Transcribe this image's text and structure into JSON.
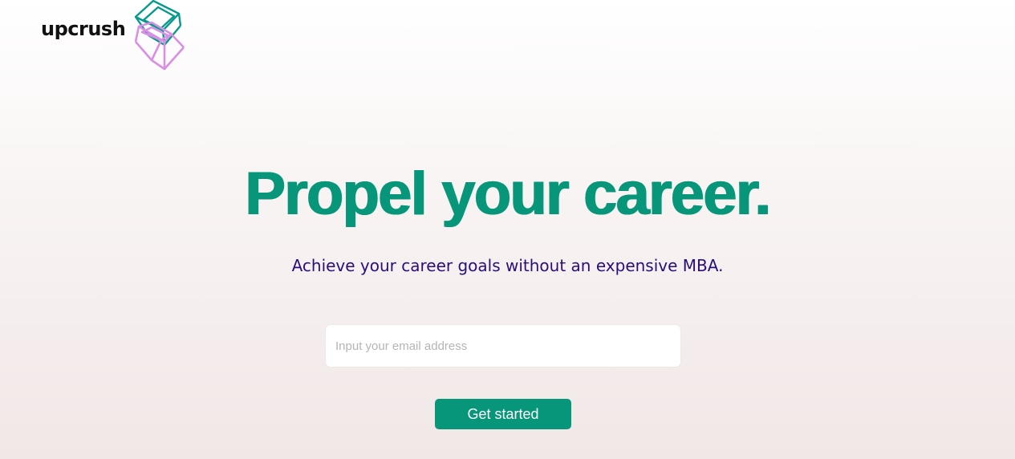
{
  "brand": {
    "name": "upcrush",
    "logo_icon": "stacked-cubes-icon",
    "cube_colors": [
      "#079a8c",
      "#d98fe3"
    ]
  },
  "hero": {
    "headline": "Propel your career.",
    "subheadline": "Achieve your career goals without an expensive MBA."
  },
  "signup": {
    "email_placeholder": "Input your email address",
    "email_value": "",
    "cta_label": "Get started"
  },
  "colors": {
    "accent": "#07967a",
    "subhead": "#2a0e7a",
    "background_top": "#ffffff",
    "background_bottom": "#f1e7e7"
  }
}
